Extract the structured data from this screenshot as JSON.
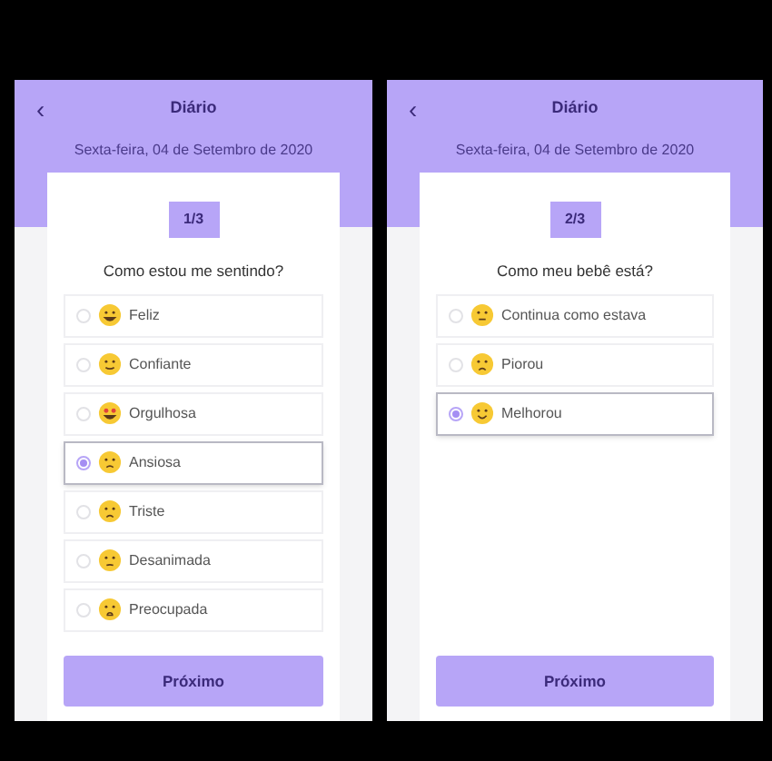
{
  "screens": [
    {
      "back": "‹",
      "title": "Diário",
      "date": "Sexta-feira, 04 de Setembro de 2020",
      "step": "1/3",
      "question": "Como estou me sentindo?",
      "options": [
        {
          "label": "Feliz",
          "selected": false
        },
        {
          "label": "Confiante",
          "selected": false
        },
        {
          "label": "Orgulhosa",
          "selected": false
        },
        {
          "label": "Ansiosa",
          "selected": true
        },
        {
          "label": "Triste",
          "selected": false
        },
        {
          "label": "Desanimada",
          "selected": false
        },
        {
          "label": "Preocupada",
          "selected": false
        }
      ],
      "button": "Próximo"
    },
    {
      "back": "‹",
      "title": "Diário",
      "date": "Sexta-feira, 04 de Setembro de 2020",
      "step": "2/3",
      "question": "Como meu bebê está?",
      "options": [
        {
          "label": "Continua como estava",
          "selected": false
        },
        {
          "label": "Piorou",
          "selected": false
        },
        {
          "label": "Melhorou",
          "selected": true
        }
      ],
      "button": "Próximo"
    }
  ]
}
